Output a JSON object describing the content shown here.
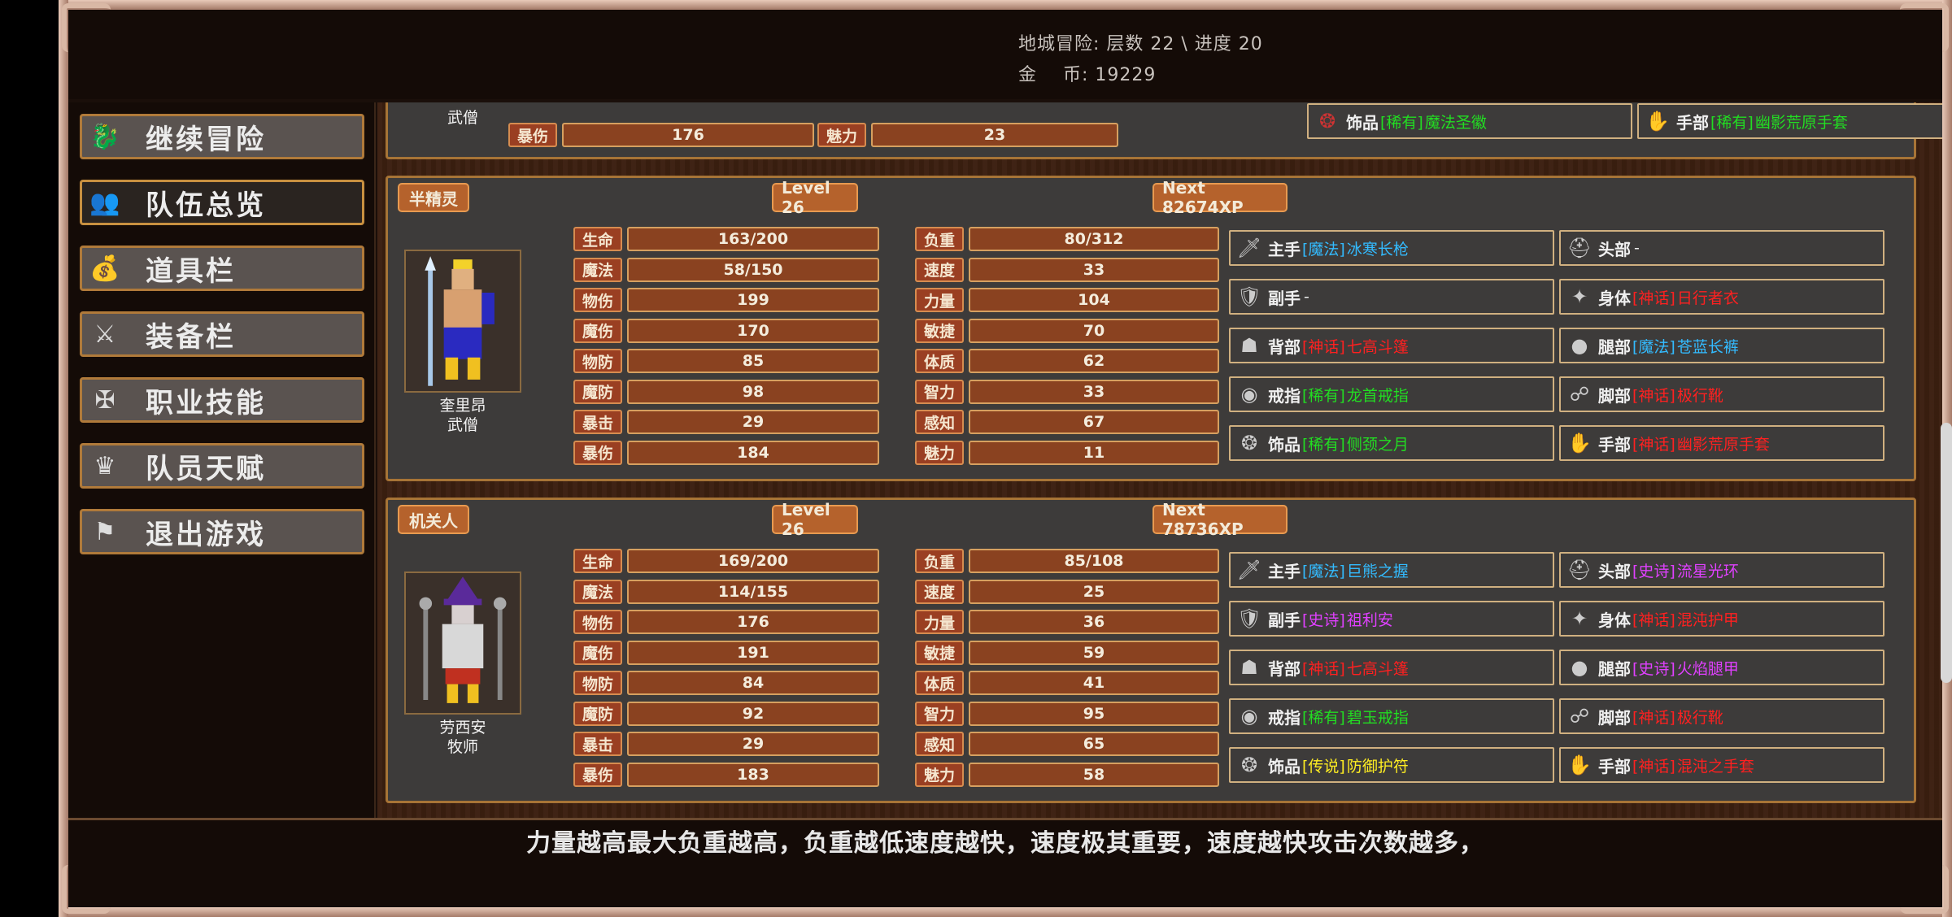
{
  "header": {
    "dungeon_label": "地城冒险:",
    "dungeon_value": "层数 22 \\ 进度 20",
    "gold_label": "金    币:",
    "gold_value": "19229"
  },
  "sidebar": {
    "items": [
      {
        "label": "继续冒险",
        "icon": "dragon-icon"
      },
      {
        "label": "队伍总览",
        "icon": "party-icon"
      },
      {
        "label": "道具栏",
        "icon": "bag-icon"
      },
      {
        "label": "装备栏",
        "icon": "gear-icon"
      },
      {
        "label": "职业技能",
        "icon": "skill-icon"
      },
      {
        "label": "队员天赋",
        "icon": "talent-icon"
      },
      {
        "label": "退出游戏",
        "icon": "flag-icon"
      }
    ]
  },
  "partial_card": {
    "class": "武僧",
    "stats": [
      {
        "label": "暴伤",
        "value": "176"
      },
      {
        "label": "魅力",
        "value": "23"
      }
    ],
    "slots": [
      {
        "type": "饰品",
        "rarity": "[稀有]",
        "name": "魔法圣徽",
        "color": "#22dd22"
      },
      {
        "type": "手部",
        "rarity": "[稀有]",
        "name": "幽影荒原手套",
        "color": "#22dd22"
      }
    ]
  },
  "members": [
    {
      "race": "半精灵",
      "level": "Level 26",
      "next": "Next 82674XP",
      "name": "奎里昂",
      "class": "武僧",
      "stats_left": [
        {
          "label": "生命",
          "value": "163/200"
        },
        {
          "label": "魔法",
          "value": "58/150"
        },
        {
          "label": "物伤",
          "value": "199"
        },
        {
          "label": "魔伤",
          "value": "170"
        },
        {
          "label": "物防",
          "value": "85"
        },
        {
          "label": "魔防",
          "value": "98"
        },
        {
          "label": "暴击",
          "value": "29"
        },
        {
          "label": "暴伤",
          "value": "184"
        }
      ],
      "stats_right": [
        {
          "label": "负重",
          "value": "80/312"
        },
        {
          "label": "速度",
          "value": "33"
        },
        {
          "label": "力量",
          "value": "104"
        },
        {
          "label": "敏捷",
          "value": "70"
        },
        {
          "label": "体质",
          "value": "62"
        },
        {
          "label": "智力",
          "value": "33"
        },
        {
          "label": "感知",
          "value": "67"
        },
        {
          "label": "魅力",
          "value": "11"
        }
      ],
      "slots": [
        {
          "type": "主手",
          "rarity": "[魔法]",
          "name": "冰寒长枪",
          "color": "#33bbff"
        },
        {
          "type": "头部",
          "rarity": "",
          "name": "-",
          "color": "#f0f0f0"
        },
        {
          "type": "副手",
          "rarity": "",
          "name": "-",
          "color": "#f0f0f0"
        },
        {
          "type": "身体",
          "rarity": "[神话]",
          "name": "日行者衣",
          "color": "#ff2020"
        },
        {
          "type": "背部",
          "rarity": "[神话]",
          "name": "七高斗篷",
          "color": "#ff2020"
        },
        {
          "type": "腿部",
          "rarity": "[魔法]",
          "name": "苍蓝长裤",
          "color": "#33bbff"
        },
        {
          "type": "戒指",
          "rarity": "[稀有]",
          "name": "龙首戒指",
          "color": "#22dd22"
        },
        {
          "type": "脚部",
          "rarity": "[神话]",
          "name": "极行靴",
          "color": "#ff2020"
        },
        {
          "type": "饰品",
          "rarity": "[稀有]",
          "name": "侧颈之月",
          "color": "#22dd22"
        },
        {
          "type": "手部",
          "rarity": "[神话]",
          "name": "幽影荒原手套",
          "color": "#ff2020"
        }
      ]
    },
    {
      "race": "机关人",
      "level": "Level 26",
      "next": "Next 78736XP",
      "name": "劳西安",
      "class": "牧师",
      "stats_left": [
        {
          "label": "生命",
          "value": "169/200"
        },
        {
          "label": "魔法",
          "value": "114/155"
        },
        {
          "label": "物伤",
          "value": "176"
        },
        {
          "label": "魔伤",
          "value": "191"
        },
        {
          "label": "物防",
          "value": "84"
        },
        {
          "label": "魔防",
          "value": "92"
        },
        {
          "label": "暴击",
          "value": "29"
        },
        {
          "label": "暴伤",
          "value": "183"
        }
      ],
      "stats_right": [
        {
          "label": "负重",
          "value": "85/108"
        },
        {
          "label": "速度",
          "value": "25"
        },
        {
          "label": "力量",
          "value": "36"
        },
        {
          "label": "敏捷",
          "value": "59"
        },
        {
          "label": "体质",
          "value": "41"
        },
        {
          "label": "智力",
          "value": "95"
        },
        {
          "label": "感知",
          "value": "65"
        },
        {
          "label": "魅力",
          "value": "58"
        }
      ],
      "slots": [
        {
          "type": "主手",
          "rarity": "[魔法]",
          "name": "巨熊之握",
          "color": "#33bbff"
        },
        {
          "type": "头部",
          "rarity": "[史诗]",
          "name": "流星光环",
          "color": "#e040ff"
        },
        {
          "type": "副手",
          "rarity": "[史诗]",
          "name": "祖利安",
          "color": "#e040ff"
        },
        {
          "type": "身体",
          "rarity": "[神话]",
          "name": "混沌护甲",
          "color": "#ff2020"
        },
        {
          "type": "背部",
          "rarity": "[神话]",
          "name": "七高斗篷",
          "color": "#ff2020"
        },
        {
          "type": "腿部",
          "rarity": "[史诗]",
          "name": "火焰腿甲",
          "color": "#e040ff"
        },
        {
          "type": "戒指",
          "rarity": "[稀有]",
          "name": "碧玉戒指",
          "color": "#22dd22"
        },
        {
          "type": "脚部",
          "rarity": "[神话]",
          "name": "极行靴",
          "color": "#ff2020"
        },
        {
          "type": "饰品",
          "rarity": "[传说]",
          "name": "防御护符",
          "color": "#ffee22"
        },
        {
          "type": "手部",
          "rarity": "[神话]",
          "name": "混沌之手套",
          "color": "#ff2020"
        }
      ]
    }
  ],
  "footer": {
    "tip": "力量越高最大负重越高，负重越低速度越快，速度极其重要，速度越快攻击次数越多，"
  }
}
